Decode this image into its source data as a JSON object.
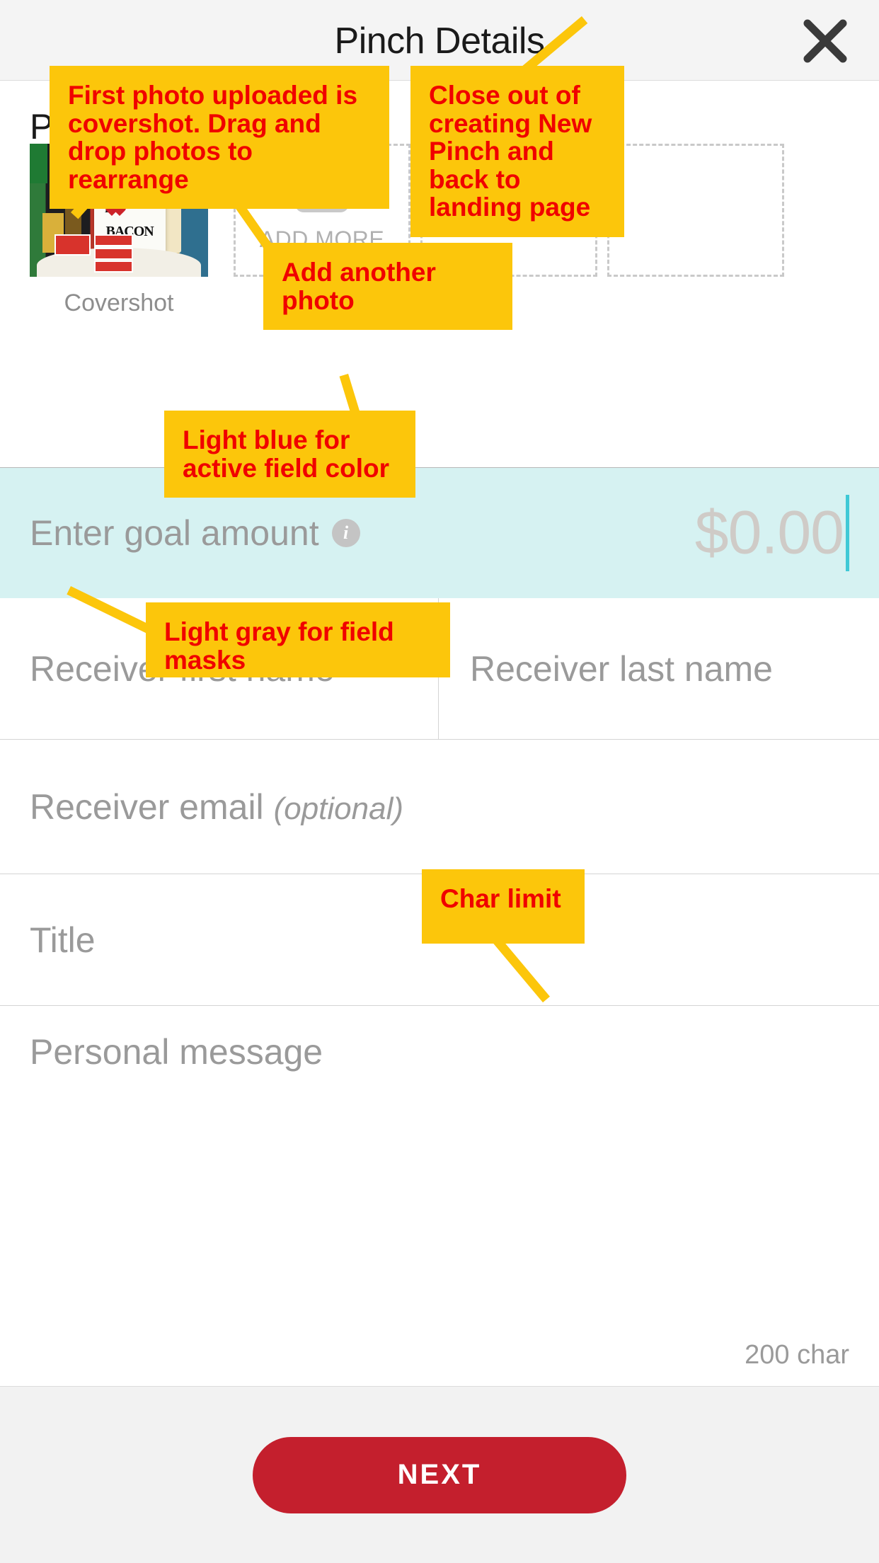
{
  "header": {
    "title": "Pinch Details",
    "close_icon": "close-icon"
  },
  "photos": {
    "section_label": "Photos",
    "covershot_caption": "Covershot",
    "add_more_label": "ADD MORE",
    "add_more_icon": "camera-icon",
    "empty_slots": 2
  },
  "fields": {
    "goal": {
      "label": "Enter goal amount",
      "info_icon": "info-icon",
      "value_placeholder": "$0.00",
      "active": true
    },
    "first_name": {
      "placeholder": "Receiver first name"
    },
    "last_name": {
      "placeholder": "Receiver last name"
    },
    "email": {
      "placeholder": "Receiver email",
      "optional_tag": "(optional)"
    },
    "title": {
      "placeholder": "Title"
    },
    "message": {
      "placeholder": "Personal message",
      "char_limit": "200 char"
    }
  },
  "footer": {
    "next_label": "NEXT"
  },
  "colors": {
    "active_field": "#d6f2f2",
    "field_mask_gray": "#9a9a9a",
    "next_button": "#c41f2d",
    "callout_bg": "#fcc60b",
    "callout_text": "#f00000",
    "caret": "#3fc9d6"
  },
  "annotations": [
    {
      "id": "covershot-note",
      "text": "First photo uploaded is covershot. Drag and drop photos to rearrange"
    },
    {
      "id": "close-note",
      "text": "Close out of creating New Pinch and back to landing page"
    },
    {
      "id": "add-photo-note",
      "text": "Add another photo"
    },
    {
      "id": "active-color-note",
      "text": "Light blue for active field color"
    },
    {
      "id": "field-mask-note",
      "text": "Light gray for field masks"
    },
    {
      "id": "char-limit-note",
      "text": "Char limit"
    }
  ]
}
